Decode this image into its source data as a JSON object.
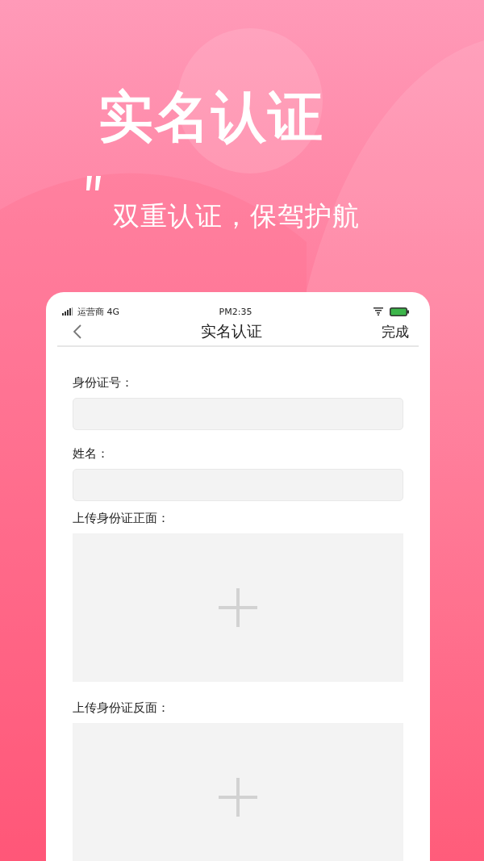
{
  "hero": {
    "title": "实名认证",
    "subtitle": "双重认证，保驾护航"
  },
  "status_bar": {
    "carrier": "运营商 4G",
    "time": "PM2:35"
  },
  "nav": {
    "title": "实名认证",
    "action": "完成"
  },
  "form": [
    {
      "kind": "text",
      "label": "身份证号："
    },
    {
      "kind": "text",
      "label": "姓名："
    },
    {
      "kind": "upload",
      "label": "上传身份证正面："
    },
    {
      "kind": "upload",
      "label": "上传身份证反面："
    }
  ]
}
